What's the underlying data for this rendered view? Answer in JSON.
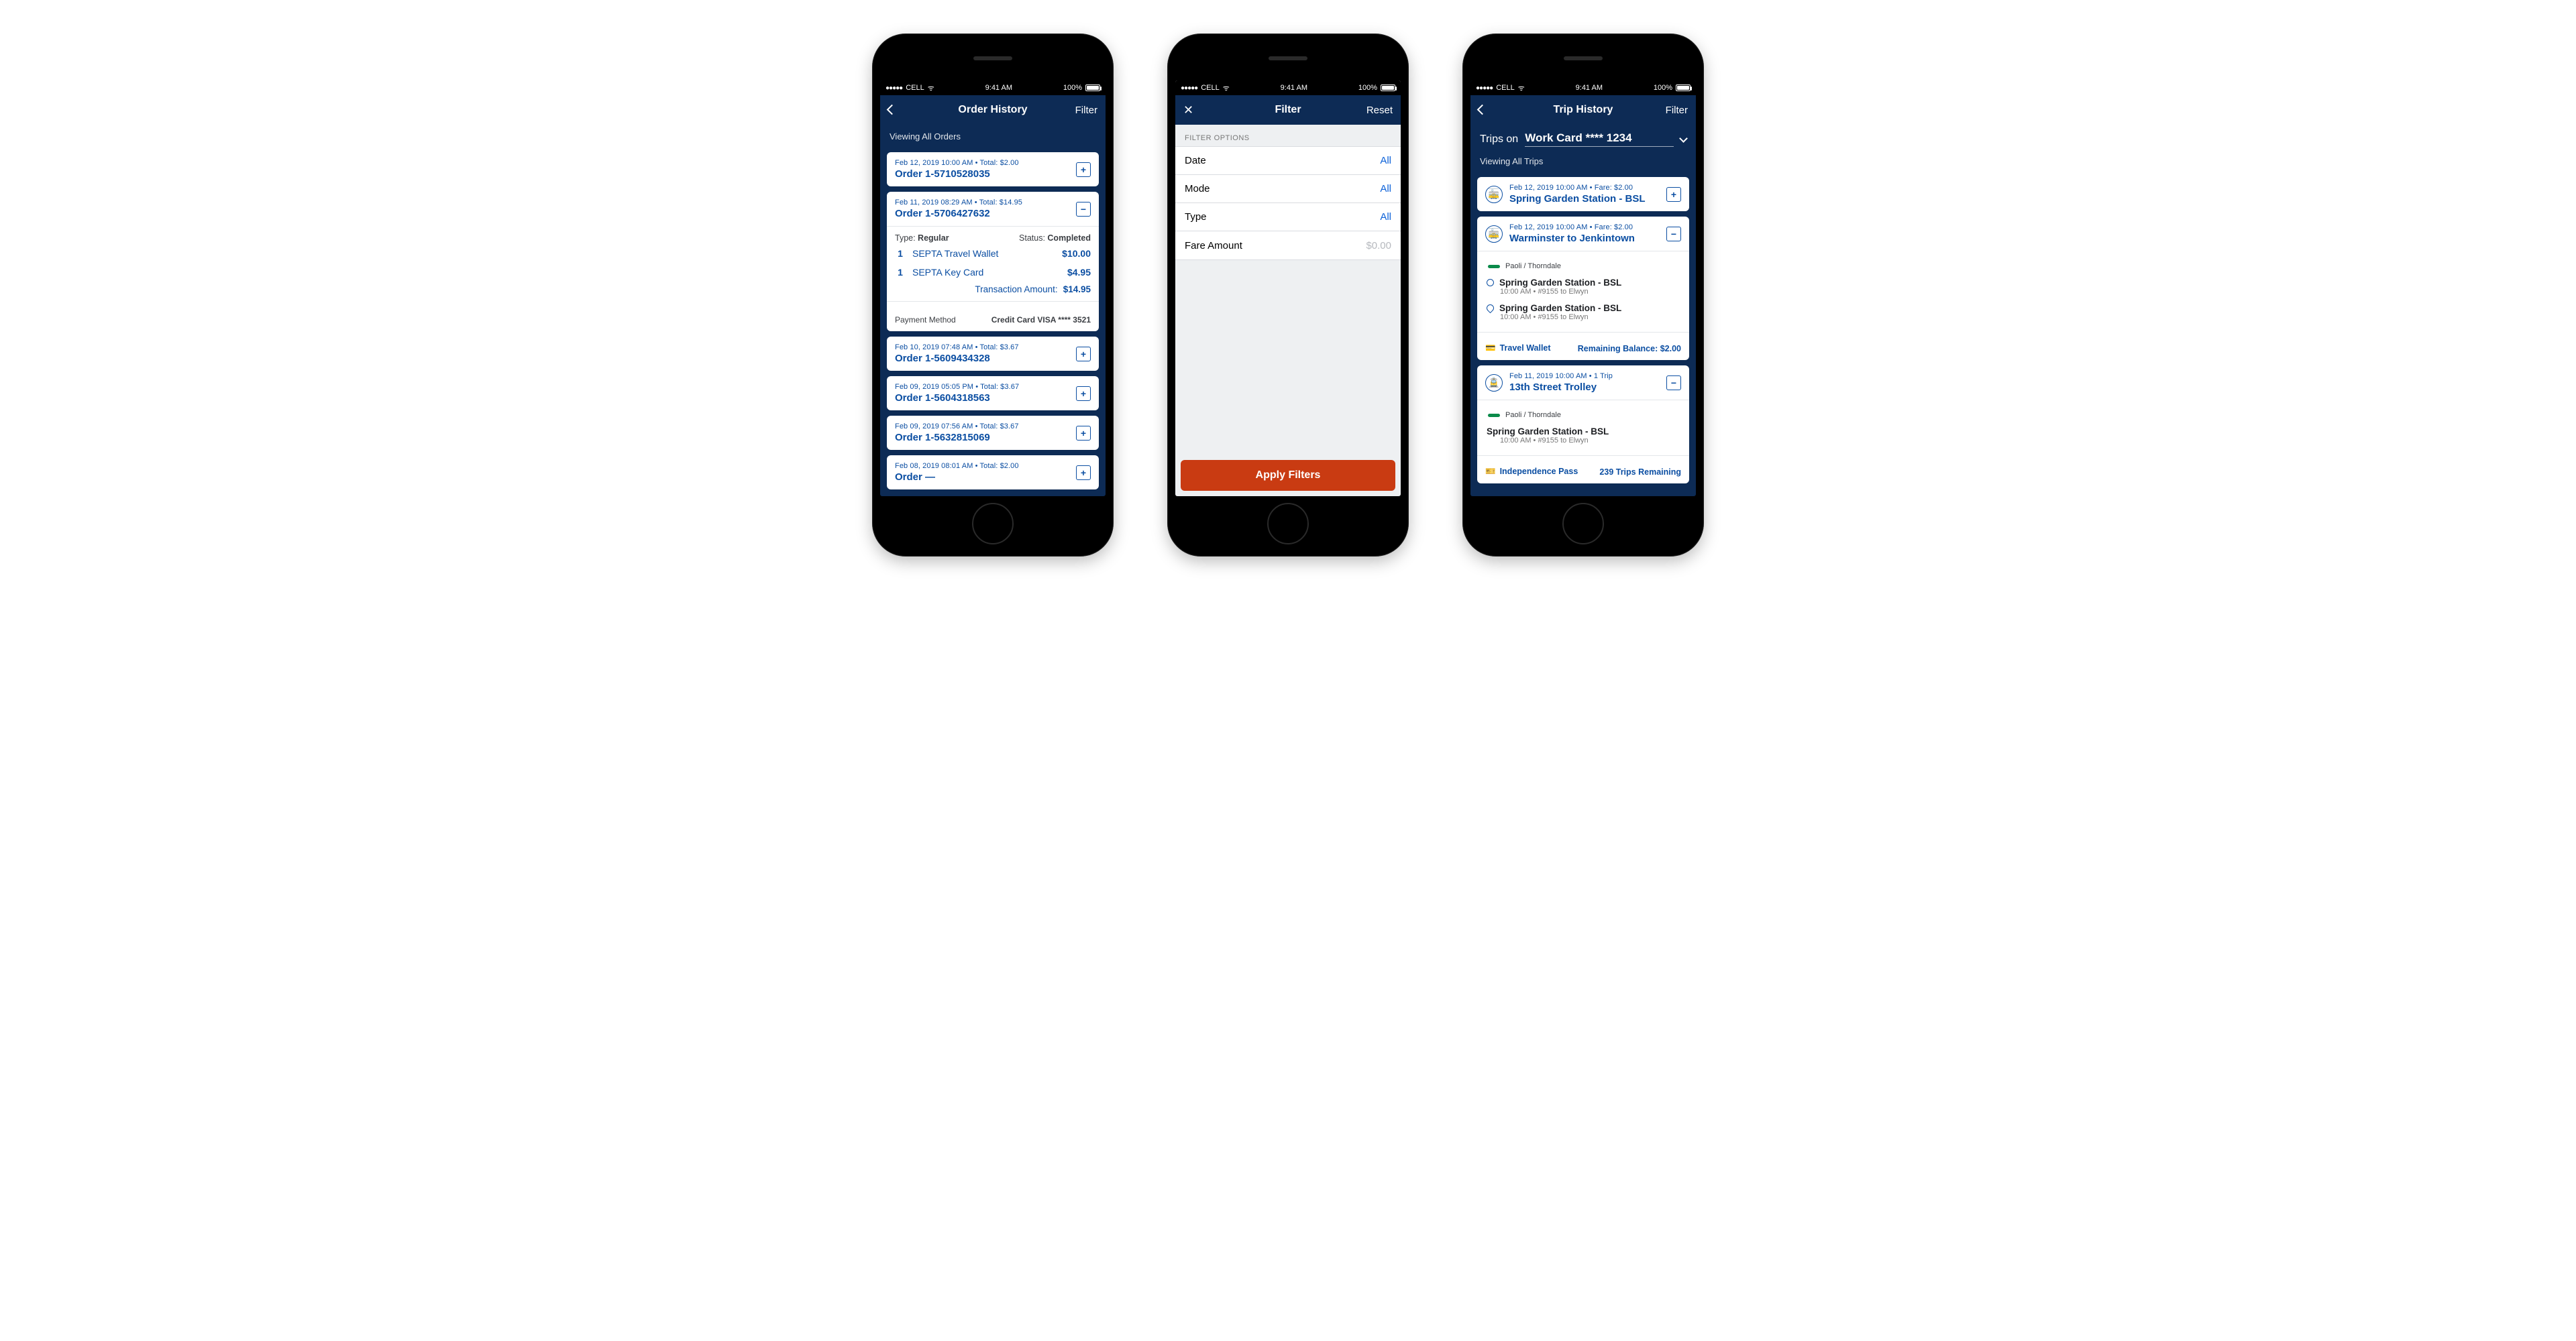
{
  "status": {
    "carrier": "CELL",
    "time": "9:41 AM",
    "battery": "100%",
    "dots": "●●●●●"
  },
  "screen1": {
    "title": "Order History",
    "right": "Filter",
    "sub": "Viewing All Orders",
    "orders": [
      {
        "meta": "Feb 12, 2019 10:00 AM  •  Total: $2.00",
        "no": "Order 1-5710528035",
        "open": false
      },
      {
        "meta": "Feb 11, 2019 08:29 AM  •  Total: $14.95",
        "no": "Order 1-5706427632",
        "open": true,
        "type_label": "Type:",
        "type": "Regular",
        "status_label": "Status:",
        "status": "Completed",
        "lines": [
          {
            "qty": "1",
            "name": "SEPTA Travel Wallet",
            "price": "$10.00"
          },
          {
            "qty": "1",
            "name": "SEPTA Key Card",
            "price": "$4.95"
          }
        ],
        "tx_label": "Transaction Amount:",
        "tx_amount": "$14.95",
        "pm_label": "Payment Method",
        "pm_value": "Credit Card VISA **** 3521"
      },
      {
        "meta": "Feb 10, 2019 07:48 AM  •  Total: $3.67",
        "no": "Order 1-5609434328",
        "open": false
      },
      {
        "meta": "Feb 09, 2019 05:05 PM  •  Total: $3.67",
        "no": "Order 1-5604318563",
        "open": false
      },
      {
        "meta": "Feb 09, 2019 07:56 AM  •  Total: $3.67",
        "no": "Order 1-5632815069",
        "open": false
      },
      {
        "meta": "Feb 08, 2019 08:01 AM  •  Total: $2.00",
        "no": "Order —",
        "open": false
      }
    ]
  },
  "screen2": {
    "title": "Filter",
    "right": "Reset",
    "section": "FILTER OPTIONS",
    "rows": [
      {
        "label": "Date",
        "value": "All"
      },
      {
        "label": "Mode",
        "value": "All"
      },
      {
        "label": "Type",
        "value": "All"
      },
      {
        "label": "Fare Amount",
        "value": "$0.00",
        "muted": true
      }
    ],
    "apply": "Apply Filters"
  },
  "screen3": {
    "title": "Trip History",
    "right": "Filter",
    "trip_lbl": "Trips on",
    "trip_val": "Work Card **** 1234",
    "sub": "Viewing All Trips",
    "cards": [
      {
        "meta": "Feb 12, 2019 10:00 AM  •  Fare: $2.00",
        "name": "Spring Garden Station - BSL",
        "open": false,
        "glyph": "🚋"
      },
      {
        "meta": "Feb 12, 2019 10:00 AM  •  Fare: $2.00",
        "name": "Warminster to Jenkintown",
        "open": true,
        "glyph": "🚋",
        "route": "Paoli / Thorndale",
        "stops": [
          {
            "kind": "start",
            "name": "Spring Garden Station - BSL",
            "sub": "10:00 AM  •  #9155 to Elwyn"
          },
          {
            "kind": "end",
            "name": "Spring Garden Station - BSL",
            "sub": "10:00 AM  •  #9155 to Elwyn"
          }
        ],
        "foot_ic": "💳",
        "foot_left": "Travel Wallet",
        "foot_right": "Remaining Balance: $2.00"
      },
      {
        "meta": "Feb 11, 2019 10:00 AM  •  1 Trip",
        "name": "13th Street Trolley",
        "open": true,
        "glyph": "🚊",
        "route": "Paoli / Thorndale",
        "stops": [
          {
            "kind": "plain",
            "name": "Spring Garden Station - BSL",
            "sub": "10:00 AM  •  #9155 to Elwyn"
          }
        ],
        "foot_ic": "🎫",
        "foot_left": "Independence Pass",
        "foot_right": "239 Trips Remaining"
      }
    ]
  }
}
